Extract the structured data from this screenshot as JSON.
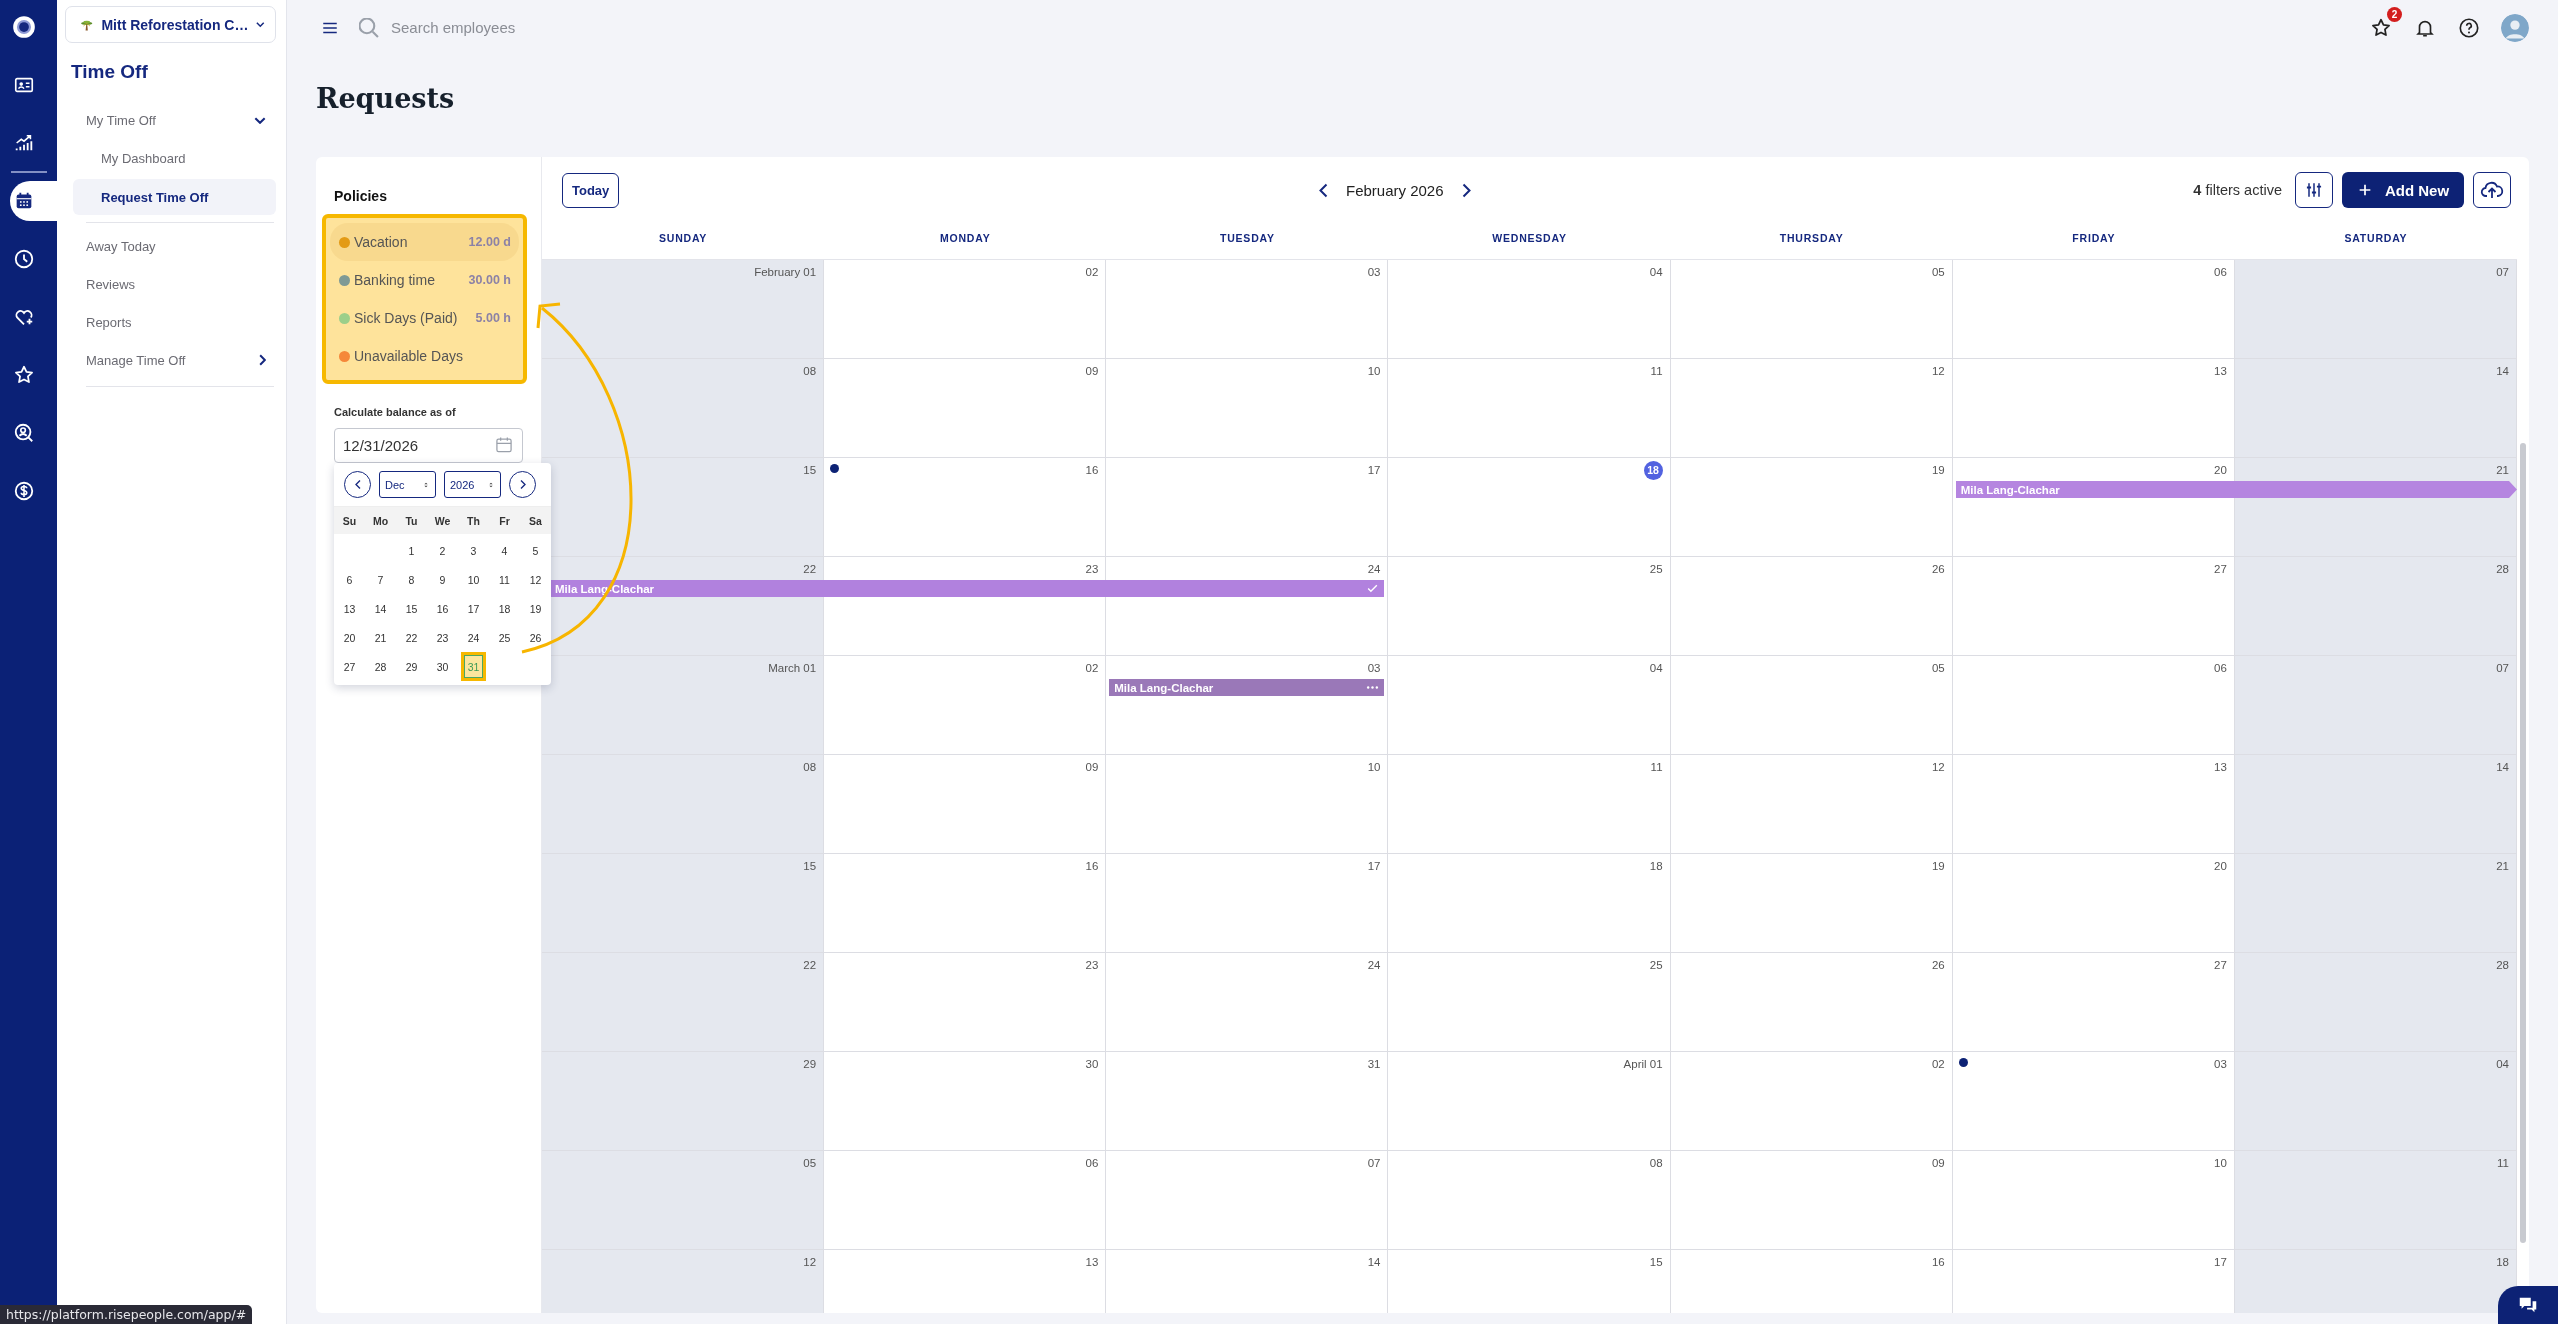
{
  "rail": {
    "top": [
      {
        "selected": false
      },
      {
        "selected": false
      },
      {
        "selected": false
      }
    ],
    "items": [
      {
        "selected": true
      },
      {
        "selected": false
      },
      {
        "selected": false
      },
      {
        "selected": false
      },
      {
        "selected": false
      },
      {
        "selected": false
      }
    ]
  },
  "company": {
    "name": "Mitt Reforestation C…"
  },
  "sidebar": {
    "title": "Time Off",
    "items": [
      {
        "kind": "group",
        "label": "My Time Off",
        "expanded": true,
        "selected": false,
        "children": [
          {
            "kind": "link",
            "label": "My Dashboard",
            "selected": false
          },
          {
            "kind": "link",
            "label": "Request Time Off",
            "selected": true
          }
        ]
      },
      {
        "kind": "link",
        "label": "Away Today",
        "selected": false
      },
      {
        "kind": "link",
        "label": "Reviews",
        "selected": false
      },
      {
        "kind": "link",
        "label": "Reports",
        "selected": false
      },
      {
        "kind": "group",
        "label": "Manage Time Off",
        "expanded": false,
        "selected": false
      }
    ]
  },
  "topbar": {
    "search": {
      "placeholder": "Search employees"
    },
    "favorites_badge": "2"
  },
  "page_title": "Requests",
  "policies": {
    "title": "Policies",
    "highlighted": true,
    "items": [
      {
        "name": "Vacation",
        "color": "#e39b16",
        "balance": "12.00 d",
        "selected": true
      },
      {
        "name": "Banking time",
        "color": "#7f9a95",
        "balance": "30.00 h",
        "selected": false
      },
      {
        "name": "Sick Days (Paid)",
        "color": "#9ccf8a",
        "balance": "5.00 h",
        "selected": false
      },
      {
        "name": "Unavailable Days",
        "color": "#f5883a",
        "selected": false
      }
    ]
  },
  "balance": {
    "label": "Calculate balance as of",
    "value": "12/31/2026"
  },
  "datepicker": {
    "month": "Dec",
    "year": "2026",
    "weekdays": [
      "Su",
      "Mo",
      "Tu",
      "We",
      "Th",
      "Fr",
      "Sa"
    ],
    "annotation_arrow": true,
    "weeks": [
      {
        "kind": "lead",
        "days": [
          {
            "label": "1",
            "selected": false
          },
          {
            "label": "2",
            "selected": false
          },
          {
            "label": "3",
            "selected": false
          },
          {
            "label": "4",
            "selected": false
          },
          {
            "label": "5",
            "selected": false
          }
        ]
      },
      {
        "kind": "full",
        "days": [
          {
            "label": "6",
            "selected": false
          },
          {
            "label": "7",
            "selected": false
          },
          {
            "label": "8",
            "selected": false
          },
          {
            "label": "9",
            "selected": false
          },
          {
            "label": "10",
            "selected": false
          },
          {
            "label": "11",
            "selected": false
          },
          {
            "label": "12",
            "selected": false
          }
        ]
      },
      {
        "kind": "full",
        "days": [
          {
            "label": "13",
            "selected": false
          },
          {
            "label": "14",
            "selected": false
          },
          {
            "label": "15",
            "selected": false
          },
          {
            "label": "16",
            "selected": false
          },
          {
            "label": "17",
            "selected": false
          },
          {
            "label": "18",
            "selected": false
          },
          {
            "label": "19",
            "selected": false
          }
        ]
      },
      {
        "kind": "full",
        "days": [
          {
            "label": "20",
            "selected": false
          },
          {
            "label": "21",
            "selected": false
          },
          {
            "label": "22",
            "selected": false
          },
          {
            "label": "23",
            "selected": false
          },
          {
            "label": "24",
            "selected": false
          },
          {
            "label": "25",
            "selected": false
          },
          {
            "label": "26",
            "selected": false
          }
        ]
      },
      {
        "kind": "full",
        "days": [
          {
            "label": "27",
            "selected": false
          },
          {
            "label": "28",
            "selected": false
          },
          {
            "label": "29",
            "selected": false
          },
          {
            "label": "30",
            "selected": false
          },
          {
            "label": "31",
            "selected": true
          }
        ]
      }
    ]
  },
  "calendar": {
    "today_button": "Today",
    "month": "February 2026",
    "filters": {
      "count": "4",
      "label": "filters active"
    },
    "add_button": "Add New",
    "weekdays": [
      {
        "label": "SUNDAY",
        "weekend": true
      },
      {
        "label": "MONDAY",
        "weekend": false
      },
      {
        "label": "TUESDAY",
        "weekend": false
      },
      {
        "label": "WEDNESDAY",
        "weekend": false
      },
      {
        "label": "THURSDAY",
        "weekend": false
      },
      {
        "label": "FRIDAY",
        "weekend": false
      },
      {
        "label": "SATURDAY",
        "weekend": true
      }
    ],
    "weeks": [
      {
        "days": [
          {
            "label": "February 01",
            "today": false,
            "dot": false
          },
          {
            "label": "02",
            "today": false,
            "dot": false
          },
          {
            "label": "03",
            "today": false,
            "dot": false
          },
          {
            "label": "04",
            "today": false,
            "dot": false
          },
          {
            "label": "05",
            "today": false,
            "dot": false
          },
          {
            "label": "06",
            "today": false,
            "dot": false
          },
          {
            "label": "07",
            "today": false,
            "dot": false
          }
        ]
      },
      {
        "days": [
          {
            "label": "08",
            "today": false,
            "dot": false
          },
          {
            "label": "09",
            "today": false,
            "dot": false
          },
          {
            "label": "10",
            "today": false,
            "dot": false
          },
          {
            "label": "11",
            "today": false,
            "dot": false
          },
          {
            "label": "12",
            "today": false,
            "dot": false
          },
          {
            "label": "13",
            "today": false,
            "dot": false
          },
          {
            "label": "14",
            "today": false,
            "dot": false
          }
        ]
      },
      {
        "days": [
          {
            "label": "15",
            "today": false,
            "dot": false
          },
          {
            "label": "16",
            "today": false,
            "dot": true
          },
          {
            "label": "17",
            "today": false,
            "dot": false
          },
          {
            "label": "18",
            "today": true,
            "dot": false
          },
          {
            "label": "19",
            "today": false,
            "dot": false
          },
          {
            "label": "20",
            "today": false,
            "dot": false,
            "event": {
              "name": "Mila Lang-Clachar",
              "kind": "continues"
            }
          },
          {
            "label": "21",
            "today": false,
            "dot": false,
            "event_continues": true
          }
        ]
      },
      {
        "days": [
          {
            "label": "22",
            "today": false,
            "dot": false,
            "event": {
              "name": "Mila Lang-Clachar",
              "kind": "approved"
            }
          },
          {
            "label": "23",
            "today": false,
            "dot": false,
            "event_continues": true
          },
          {
            "label": "24",
            "today": false,
            "dot": false,
            "event_continues": true
          },
          {
            "label": "25",
            "today": false,
            "dot": false
          },
          {
            "label": "26",
            "today": false,
            "dot": false
          },
          {
            "label": "27",
            "today": false,
            "dot": false
          },
          {
            "label": "28",
            "today": false,
            "dot": false
          }
        ]
      },
      {
        "days": [
          {
            "label": "March 01",
            "today": false,
            "dot": false
          },
          {
            "label": "02",
            "today": false,
            "dot": false
          },
          {
            "label": "03",
            "today": false,
            "dot": false,
            "event": {
              "name": "Mila Lang-Clachar",
              "kind": "pending"
            }
          },
          {
            "label": "04",
            "today": false,
            "dot": false
          },
          {
            "label": "05",
            "today": false,
            "dot": false
          },
          {
            "label": "06",
            "today": false,
            "dot": false
          },
          {
            "label": "07",
            "today": false,
            "dot": false
          }
        ]
      },
      {
        "days": [
          {
            "label": "08",
            "today": false,
            "dot": false
          },
          {
            "label": "09",
            "today": false,
            "dot": false
          },
          {
            "label": "10",
            "today": false,
            "dot": false
          },
          {
            "label": "11",
            "today": false,
            "dot": false
          },
          {
            "label": "12",
            "today": false,
            "dot": false
          },
          {
            "label": "13",
            "today": false,
            "dot": false
          },
          {
            "label": "14",
            "today": false,
            "dot": false
          }
        ]
      },
      {
        "days": [
          {
            "label": "15",
            "today": false,
            "dot": false
          },
          {
            "label": "16",
            "today": false,
            "dot": false
          },
          {
            "label": "17",
            "today": false,
            "dot": false
          },
          {
            "label": "18",
            "today": false,
            "dot": false
          },
          {
            "label": "19",
            "today": false,
            "dot": false
          },
          {
            "label": "20",
            "today": false,
            "dot": false
          },
          {
            "label": "21",
            "today": false,
            "dot": false
          }
        ]
      },
      {
        "days": [
          {
            "label": "22",
            "today": false,
            "dot": false
          },
          {
            "label": "23",
            "today": false,
            "dot": false
          },
          {
            "label": "24",
            "today": false,
            "dot": false
          },
          {
            "label": "25",
            "today": false,
            "dot": false
          },
          {
            "label": "26",
            "today": false,
            "dot": false
          },
          {
            "label": "27",
            "today": false,
            "dot": false
          },
          {
            "label": "28",
            "today": false,
            "dot": false
          }
        ]
      },
      {
        "days": [
          {
            "label": "29",
            "today": false,
            "dot": false
          },
          {
            "label": "30",
            "today": false,
            "dot": false
          },
          {
            "label": "31",
            "today": false,
            "dot": false
          },
          {
            "label": "April 01",
            "today": false,
            "dot": false
          },
          {
            "label": "02",
            "today": false,
            "dot": false
          },
          {
            "label": "03",
            "today": false,
            "dot": true
          },
          {
            "label": "04",
            "today": false,
            "dot": false
          }
        ]
      },
      {
        "days": [
          {
            "label": "05",
            "today": false,
            "dot": false
          },
          {
            "label": "06",
            "today": false,
            "dot": false
          },
          {
            "label": "07",
            "today": false,
            "dot": false
          },
          {
            "label": "08",
            "today": false,
            "dot": false
          },
          {
            "label": "09",
            "today": false,
            "dot": false
          },
          {
            "label": "10",
            "today": false,
            "dot": false
          },
          {
            "label": "11",
            "today": false,
            "dot": false
          }
        ]
      },
      {
        "days": [
          {
            "label": "12",
            "today": false,
            "dot": false
          },
          {
            "label": "13",
            "today": false,
            "dot": false
          },
          {
            "label": "14",
            "today": false,
            "dot": false
          },
          {
            "label": "15",
            "today": false,
            "dot": false
          },
          {
            "label": "16",
            "today": false,
            "dot": false
          },
          {
            "label": "17",
            "today": false,
            "dot": false
          },
          {
            "label": "18",
            "today": false,
            "dot": false
          }
        ]
      }
    ]
  },
  "status_url": "https://platform.risepeople.com/app/#"
}
